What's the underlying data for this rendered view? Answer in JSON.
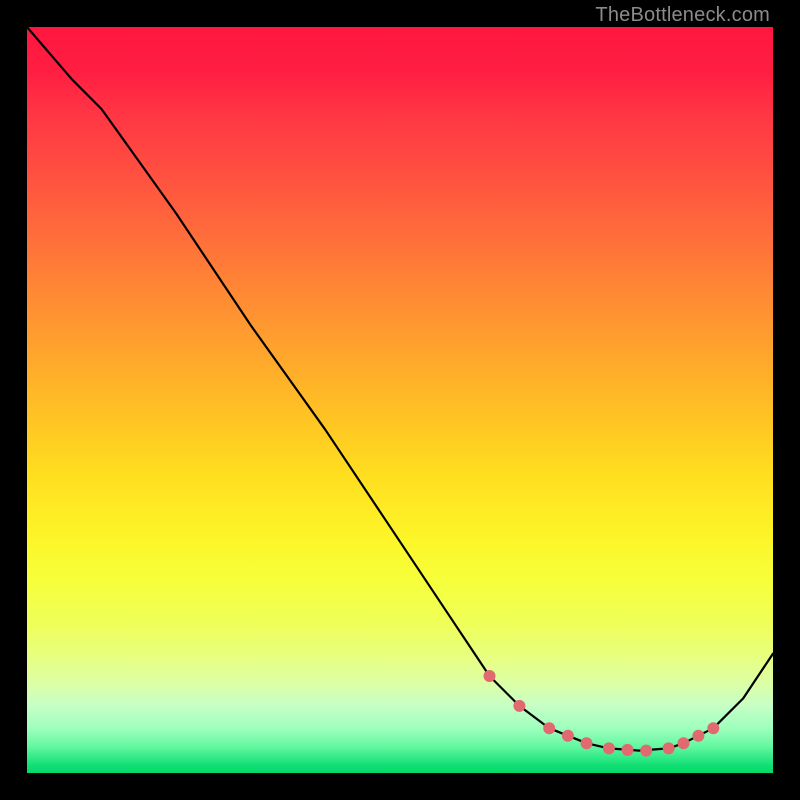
{
  "watermark": "TheBottleneck.com",
  "chart_data": {
    "type": "line",
    "title": "",
    "xlabel": "",
    "ylabel": "",
    "xlim": [
      0,
      100
    ],
    "ylim": [
      0,
      100
    ],
    "series": [
      {
        "name": "bottleneck-curve",
        "x": [
          0,
          6,
          10,
          20,
          30,
          40,
          50,
          58,
          62,
          66,
          70,
          75,
          78,
          82,
          86,
          88,
          92,
          96,
          100
        ],
        "y": [
          100,
          93,
          89,
          75,
          60,
          46,
          31,
          19,
          13,
          9,
          6,
          4,
          3.3,
          3,
          3.3,
          4,
          6,
          10,
          16
        ]
      }
    ],
    "markers": {
      "name": "optimal-range-points",
      "x": [
        62,
        66,
        70,
        72.5,
        75,
        78,
        80.5,
        83,
        86,
        88,
        90,
        92
      ],
      "y": [
        13,
        9,
        6,
        5,
        4,
        3.3,
        3.1,
        3,
        3.3,
        4,
        5,
        6
      ]
    },
    "gradient_stops": [
      {
        "pos": 0,
        "color": "#ff163f"
      },
      {
        "pos": 50,
        "color": "#ffc224"
      },
      {
        "pos": 75,
        "color": "#f6ff3a"
      },
      {
        "pos": 100,
        "color": "#06d96a"
      }
    ]
  }
}
